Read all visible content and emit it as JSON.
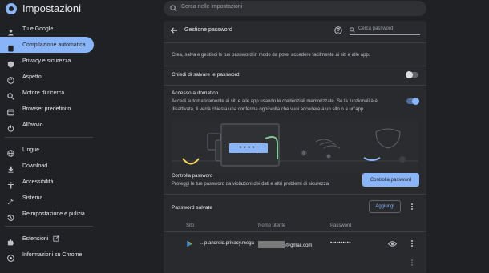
{
  "app": {
    "title": "Impostazioni"
  },
  "search": {
    "placeholder": "Cerca nelle impostazioni"
  },
  "sidebar": {
    "items": [
      {
        "label": "Tu e Google",
        "icon": "person-icon"
      },
      {
        "label": "Compilazione automatica",
        "icon": "clipboard-icon",
        "active": true
      },
      {
        "label": "Privacy e sicurezza",
        "icon": "shield-icon"
      },
      {
        "label": "Aspetto",
        "icon": "palette-icon"
      },
      {
        "label": "Motore di ricerca",
        "icon": "search-icon"
      },
      {
        "label": "Browser predefinito",
        "icon": "browser-icon"
      },
      {
        "label": "All'avvio",
        "icon": "power-icon"
      },
      {
        "label": "Lingue",
        "icon": "globe-icon"
      },
      {
        "label": "Download",
        "icon": "download-icon"
      },
      {
        "label": "Accessibilità",
        "icon": "accessibility-icon"
      },
      {
        "label": "Sistema",
        "icon": "wrench-icon"
      },
      {
        "label": "Reimpostazione e pulizia",
        "icon": "history-icon"
      },
      {
        "label": "Estensioni",
        "icon": "puzzle-icon"
      },
      {
        "label": "Informazioni su Chrome",
        "icon": "chrome-icon"
      }
    ]
  },
  "main": {
    "header": {
      "title": "Gestione password",
      "search_placeholder": "Cerca password"
    },
    "description": "Crea, salva e gestisci le tue password in modo da poter accedere facilmente ai siti e alle app.",
    "offer_save": {
      "label": "Chiedi di salvare le password",
      "enabled": false
    },
    "auto_signin": {
      "label": "Accesso automatico",
      "description": "Accedi automaticamente ai siti e alle app usando le credenziali memorizzate. Se la funzionalità è disattivata, ti verrà chiesta una conferma ogni volta che vuoi accedere a un sito o a un'app.",
      "enabled": true
    },
    "check": {
      "title": "Controlla password",
      "description": "Proteggi le tue password da violazioni dei dati e altri problemi di sicurezza",
      "button": "Controlla password"
    },
    "saved": {
      "title": "Password salvate",
      "add_button": "Aggiungi",
      "columns": {
        "site": "Sito",
        "username": "Nome utente",
        "password": "Password"
      },
      "rows": [
        {
          "site": "...p.android.privacy.mega",
          "username_suffix": "@gmail.com",
          "password": "••••••••••"
        }
      ]
    }
  },
  "colors": {
    "accent": "#8ab4f8",
    "background": "#202124",
    "panel": "#292a2d"
  }
}
